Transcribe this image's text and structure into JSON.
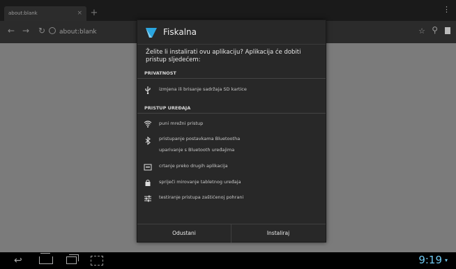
{
  "browser": {
    "tab_title": "about:blank",
    "tab_close": "×",
    "new_tab": "+",
    "url": "about:blank",
    "icons": [
      "back-arrow-icon",
      "forward-arrow-icon",
      "reload-icon",
      "globe-icon",
      "star-icon",
      "search-icon",
      "bookmarks-icon",
      "overflow-menu-icon"
    ]
  },
  "dialog": {
    "app_name": "Fiskalna",
    "question": "Želite li instalirati ovu aplikaciju? Aplikacija će dobiti pristup sljedećem:",
    "sections": [
      {
        "title": "PRIVATNOST",
        "permissions": [
          {
            "icon": "usb-icon",
            "lines": [
              "izmjena ili brisanje sadržaja SD kartice"
            ]
          }
        ]
      },
      {
        "title": "PRISTUP UREĐAJA",
        "permissions": [
          {
            "icon": "wifi-icon",
            "lines": [
              "puni mrežni pristup"
            ]
          },
          {
            "icon": "bluetooth-icon",
            "lines": [
              "pristupanje postavkama Bluetootha",
              "uparivanje s Bluetooth uređajima"
            ]
          },
          {
            "icon": "overlay-icon",
            "lines": [
              "crtanje preko drugih aplikacija"
            ]
          },
          {
            "icon": "lock-icon",
            "lines": [
              "spriječi mirovanje tabletnog uređaja"
            ]
          },
          {
            "icon": "settings-sliders-icon",
            "lines": [
              "testiranje pristupa zaštićenoj pohrani"
            ]
          }
        ]
      }
    ],
    "buttons": {
      "cancel": "Odustani",
      "install": "Instaliraj"
    }
  },
  "system_bar": {
    "time": "9:19",
    "accent": "#6ec7ef"
  }
}
